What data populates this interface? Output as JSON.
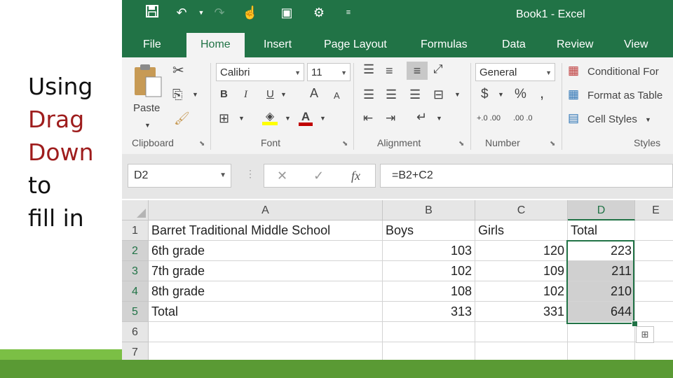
{
  "caption": {
    "line1": "Using",
    "line2": "Drag",
    "line3": "Down",
    "line4": "to",
    "line5": "fill in"
  },
  "window": {
    "title": "Book1 - Excel"
  },
  "tabs": [
    "File",
    "Home",
    "Insert",
    "Page Layout",
    "Formulas",
    "Data",
    "Review",
    "View"
  ],
  "ribbon": {
    "clipboard": {
      "paste": "Paste",
      "label": "Clipboard"
    },
    "font": {
      "name": "Calibri",
      "size": "11",
      "bold": "B",
      "italic": "I",
      "underline": "U",
      "grow": "A",
      "shrink": "A",
      "label": "Font"
    },
    "alignment": {
      "label": "Alignment"
    },
    "number": {
      "format": "General",
      "currency": "$",
      "percent": "%",
      "comma": ",",
      "inc_decimal": "+.0 .00",
      "dec_decimal": ".00 .0",
      "label": "Number"
    },
    "styles": {
      "conditional": "Conditional For",
      "format_table": "Format as Table",
      "cell_styles": "Cell Styles",
      "label": "Styles"
    }
  },
  "formula_bar": {
    "name_box": "D2",
    "formula": "=B2+C2",
    "fx": "fx"
  },
  "sheet": {
    "columns": [
      "A",
      "B",
      "C",
      "D",
      "E"
    ],
    "rows": [
      "1",
      "2",
      "3",
      "4",
      "5",
      "6",
      "7"
    ],
    "data": [
      [
        "Barret Traditional Middle School",
        "Boys",
        "Girls",
        "Total"
      ],
      [
        "6th grade",
        "103",
        "120",
        "223"
      ],
      [
        "7th grade",
        "102",
        "109",
        "211"
      ],
      [
        "8th grade",
        "108",
        "102",
        "210"
      ],
      [
        "Total",
        "313",
        "331",
        "644"
      ]
    ]
  },
  "colors": {
    "accent": "#217346",
    "caption_red": "#9e1c1c",
    "footer_green": "#5a9a34"
  }
}
